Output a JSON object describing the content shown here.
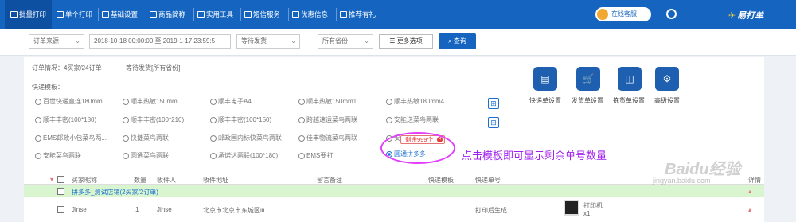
{
  "nav": {
    "items": [
      "批量打印",
      "单个打印",
      "基础设置",
      "商品简称",
      "实用工具",
      "短信服务",
      "优惠信息",
      "推荐有礼"
    ],
    "customer_service": "在线客服",
    "logo": "易打单"
  },
  "filters": {
    "order_source": "订单来源",
    "date_range": "2018-10-18 00:00:00 至 2019-1-17 23:59:5",
    "status": "等待发货",
    "province": "所有省份",
    "more_options": "更多选项",
    "query": "查询"
  },
  "summary": {
    "order_info": "订单情况：4买家/24订单",
    "status_info": "等待发货[所有省份]",
    "template_label": "快递模板："
  },
  "templates": [
    "百世快递直连180mm",
    "顺丰热敏150mm",
    "顺丰电子A4",
    "顺丰热敏150mm1",
    "顺丰热敏180mm4",
    "顺丰丰密(100*180)",
    "顺丰丰密(100*210)",
    "顺丰丰密(100*150)",
    "跨越速运菜鸟两联",
    "安能送菜鸟两联",
    "EMS邮政小包菜鸟两...",
    "快捷菜鸟两联",
    "邮政国内标快菜鸟两联",
    "佳丰物流菜鸟两联",
    "安",
    "安能菜鸟两联",
    "圆通菜鸟两联",
    "承诺达两联(100*180)",
    "EMS要打",
    "圆通拼多多"
  ],
  "side_buttons": {
    "add": "⊞",
    "remove": "⊟"
  },
  "actions": [
    "快递单设置",
    "发货单设置",
    "拣货单设置",
    "高级设置"
  ],
  "bubble": {
    "text": "剩余999个"
  },
  "annotation": "点击模板即可显示剩余单号数量",
  "table": {
    "headers": [
      "买家昵称",
      "数量",
      "收件人",
      "收件地址",
      "留言备注",
      "快递模板",
      "快递单号",
      "详情"
    ],
    "group": "拼多多_测试店铺(2买家/2订单)",
    "row": {
      "buyer": "Jinse",
      "qty": "1",
      "receiver": "Jinse",
      "address": "北京市北京市东城区iii",
      "tracking": "打印后生成",
      "printer": "打印机",
      "count": "x1"
    }
  },
  "watermark": {
    "main": "Baidu经验",
    "sub": "jingyan.baidu.com"
  }
}
